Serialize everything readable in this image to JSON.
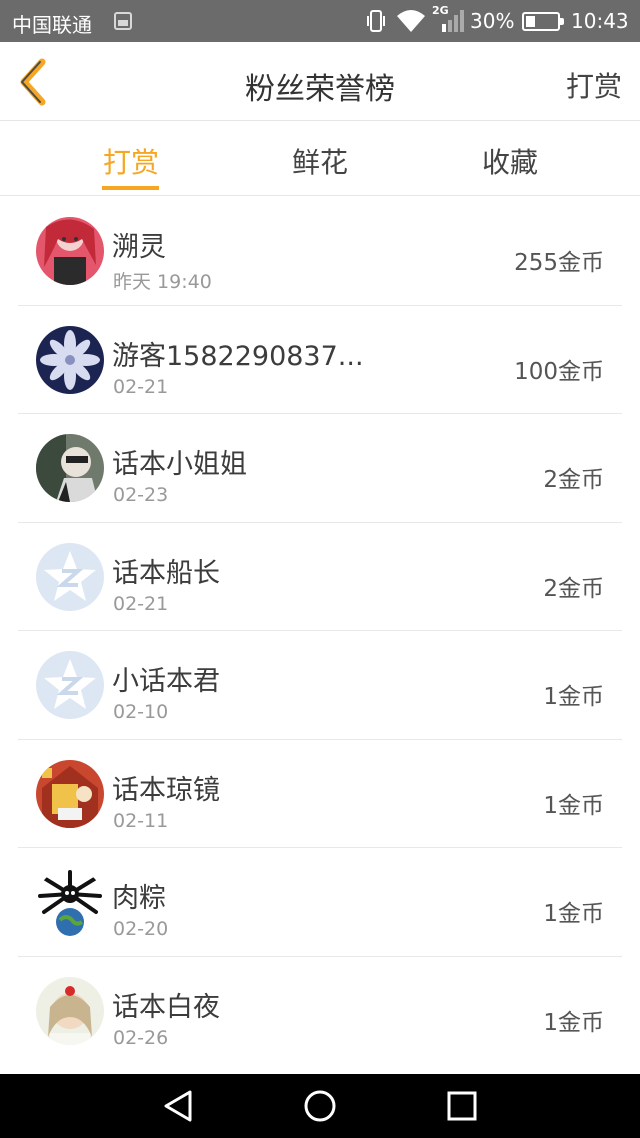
{
  "status_bar": {
    "carrier": "中国联通",
    "network_type": "2G",
    "battery_percent": "30%",
    "battery_level": 0.3,
    "time": "10:43",
    "icons": [
      "image-icon",
      "vibrate-icon",
      "wifi-icon",
      "signal-icon",
      "battery-icon"
    ]
  },
  "header": {
    "title": "粉丝荣誉榜",
    "right_action": "打赏",
    "back_icon": "chevron-left-icon",
    "accent_color": "#f5a623"
  },
  "tabs": [
    {
      "label": "打赏",
      "active": true
    },
    {
      "label": "鲜花",
      "active": false
    },
    {
      "label": "收藏",
      "active": false
    }
  ],
  "fans": [
    {
      "name": "溯灵",
      "date": "昨天 19:40",
      "amount": "255金币",
      "avatar": "anime-girl-red"
    },
    {
      "name": "游客1582290837...",
      "date": "02-21",
      "amount": "100金币",
      "avatar": "snowflake-flower"
    },
    {
      "name": "话本小姐姐",
      "date": "02-23",
      "amount": "2金币",
      "avatar": "photo-person"
    },
    {
      "name": "话本船长",
      "date": "02-21",
      "amount": "2金币",
      "avatar": "default-z-logo"
    },
    {
      "name": "小话本君",
      "date": "02-10",
      "amount": "1金币",
      "avatar": "default-z-logo"
    },
    {
      "name": "话本琼镜",
      "date": "02-11",
      "amount": "1金币",
      "avatar": "illustration-red"
    },
    {
      "name": "肉粽",
      "date": "02-20",
      "amount": "1金币",
      "avatar": "spider-globe"
    },
    {
      "name": "话本白夜",
      "date": "02-26",
      "amount": "1金币",
      "avatar": "girl-portrait"
    }
  ],
  "nav_bar": {
    "icons": [
      "nav-back-icon",
      "nav-home-icon",
      "nav-recent-icon"
    ]
  }
}
